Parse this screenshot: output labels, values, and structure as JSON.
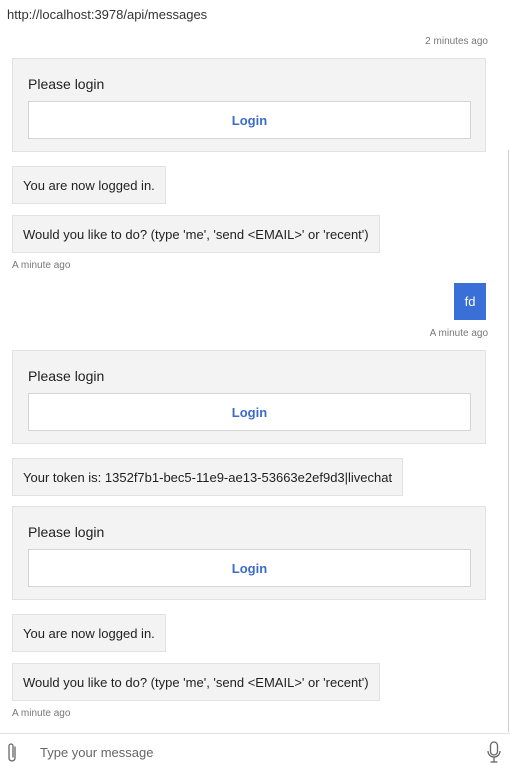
{
  "browser": {
    "url": "http://localhost:3978/api/messages"
  },
  "conversation": {
    "timestamps": {
      "t1": "2 minutes ago",
      "t2": "A minute ago",
      "t3": "A minute ago",
      "t4": "A minute ago"
    },
    "login_card_1": {
      "title": "Please login",
      "button": "Login"
    },
    "msg_logged_in_1": "You are now logged in.",
    "msg_prompt_1": "Would you like to do? (type 'me', 'send <EMAIL>' or 'recent')",
    "user_msg": "fd",
    "login_card_2": {
      "title": "Please login",
      "button": "Login"
    },
    "msg_token": "Your token is: 1352f7b1-bec5-11e9-ae13-53663e2ef9d3|livechat",
    "login_card_3": {
      "title": "Please login",
      "button": "Login"
    },
    "msg_logged_in_2": "You are now logged in.",
    "msg_prompt_2": "Would you like to do? (type 'me', 'send <EMAIL>' or 'recent')"
  },
  "input": {
    "placeholder": "Type your message"
  },
  "icons": {
    "attach": "paperclip-icon",
    "mic": "microphone-icon"
  },
  "colors": {
    "accent": "#3a6fd8",
    "link": "#3b6cc9",
    "bubble_bg": "#f3f3f3"
  }
}
